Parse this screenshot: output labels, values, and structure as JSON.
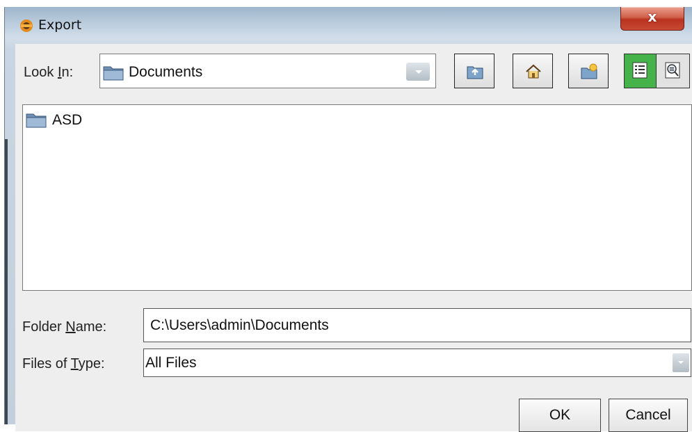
{
  "dialog": {
    "title": "Export",
    "close_label": "x",
    "colors": {
      "close_button": "#c94a35",
      "active_view_toggle": "#46b34a"
    }
  },
  "look_in": {
    "label_prefix": "Look ",
    "label_mnemonic": "I",
    "label_suffix": "n:",
    "selected": "Documents",
    "icon": "folder-icon"
  },
  "toolbar": {
    "buttons": [
      {
        "name": "up-one-level",
        "icon": "folder-up-icon"
      },
      {
        "name": "home",
        "icon": "home-icon"
      },
      {
        "name": "new-folder",
        "icon": "new-folder-icon"
      }
    ],
    "view_toggle": {
      "list_icon": "list-view-icon",
      "details_icon": "details-view-icon",
      "active": "list"
    }
  },
  "file_list": {
    "items": [
      {
        "label": "ASD",
        "icon": "folder-icon"
      }
    ]
  },
  "folder_name": {
    "label_prefix": "Folder ",
    "label_mnemonic": "N",
    "label_suffix": "ame:",
    "value": "C:\\Users\\admin\\Documents"
  },
  "files_of_type": {
    "label_prefix": "Files of ",
    "label_mnemonic": "T",
    "label_suffix": "ype:",
    "value": "All Files"
  },
  "actions": {
    "ok_label": "OK",
    "cancel_label": "Cancel"
  }
}
